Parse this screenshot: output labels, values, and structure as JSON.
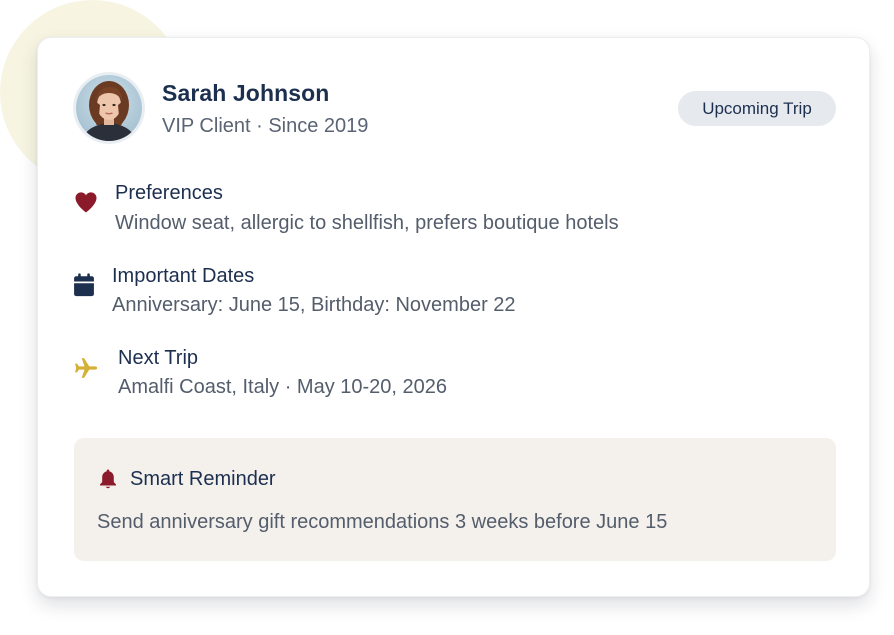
{
  "client": {
    "name": "Sarah Johnson",
    "subtitle": "VIP Client · Since 2019",
    "badge": "Upcoming Trip"
  },
  "details": [
    {
      "icon": "heart-icon",
      "title": "Preferences",
      "text": "Window seat, allergic to shellfish, prefers boutique hotels",
      "color": "#8b1a2b"
    },
    {
      "icon": "calendar-icon",
      "title": "Important Dates",
      "text": "Anniversary: June 15, Birthday: November 22",
      "color": "#1d2f4f"
    },
    {
      "icon": "airplane-icon",
      "title": "Next Trip",
      "text": "Amalfi Coast, Italy · May 10-20, 2026",
      "color": "#d4b036"
    }
  ],
  "reminder": {
    "icon": "bell-icon",
    "title": "Smart Reminder",
    "text": "Send anniversary gift recommendations 3 weeks before June 15",
    "color": "#8b1a2b"
  }
}
